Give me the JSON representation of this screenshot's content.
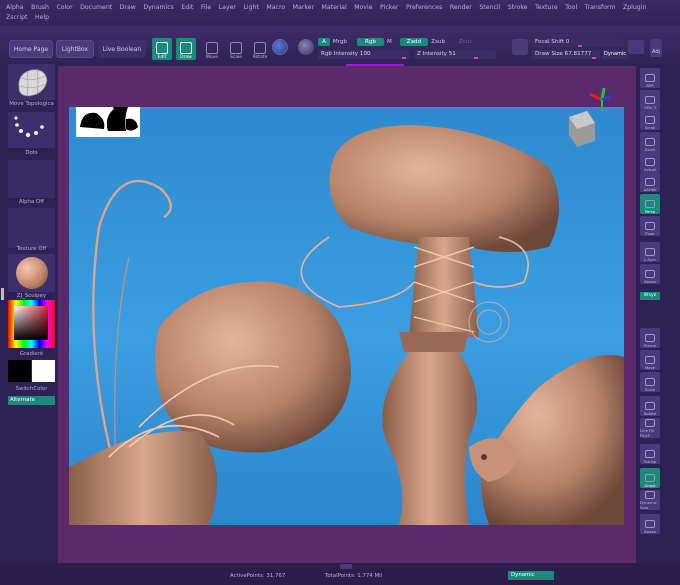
{
  "menu": [
    "Alpha",
    "Brush",
    "Color",
    "Document",
    "Draw",
    "Dynamics",
    "Edit",
    "File",
    "Layer",
    "Light",
    "Macro",
    "Marker",
    "Material",
    "Movie",
    "Picker",
    "Preferences",
    "Render",
    "Stencil",
    "Stroke",
    "Texture",
    "Tool",
    "Transform",
    "Zplugin",
    "Zscript",
    "Help"
  ],
  "shelf": {
    "home_page": "Home Page",
    "lightbox": "LightBox",
    "live_boolean": "Live Boolean",
    "tools": [
      {
        "label": "Edit",
        "on": true
      },
      {
        "label": "Draw",
        "on": true
      },
      {
        "label": "Move",
        "on": false
      },
      {
        "label": "Scale",
        "on": false
      },
      {
        "label": "Rotate",
        "on": false
      }
    ],
    "a_chip": "A",
    "mrgb": "Mrgb",
    "rgb": "Rgb",
    "m": "M",
    "zadd": "Zadd",
    "zsub": "Zsub",
    "zcut": "Zcut",
    "rgb_intensity": "Rgb Intensity 100",
    "z_intensity": "Z Intensity 51",
    "focal_shift": "Focal Shift 0",
    "draw_size": "Draw Size 67.81777",
    "dynamic": "Dynamic",
    "adj": "Adj"
  },
  "left": {
    "brush_label": "Move Topologica",
    "stroke_label": "Dots",
    "alpha_label": "Alpha Off",
    "texture_label": "Texture Off",
    "material_label": "ZJ_Sculpey",
    "gradient_label": "Gradient",
    "switch_color": "SwitchColor",
    "alternate": "Alternate"
  },
  "right": {
    "buttons": [
      {
        "label": "BPR",
        "on": false
      },
      {
        "label": "SPix 3",
        "on": false
      },
      {
        "label": "Scroll",
        "on": false
      },
      {
        "label": "Zoom",
        "on": false
      },
      {
        "label": "Actual",
        "on": false
      },
      {
        "label": "AAHalf",
        "on": false
      },
      {
        "label": "Persp",
        "on": true
      },
      {
        "label": "Floor",
        "on": false
      },
      {
        "label": "L.Sym",
        "on": false
      },
      {
        "label": "Xpose",
        "on": false
      },
      {
        "label": "Frame",
        "on": false
      },
      {
        "label": "Move",
        "on": false
      },
      {
        "label": "Scale",
        "on": false
      },
      {
        "label": "Rotate",
        "on": false
      },
      {
        "label": "Line Fill PolyF",
        "on": false
      },
      {
        "label": "Transp",
        "on": false
      },
      {
        "label": "Ghost",
        "on": true
      },
      {
        "label": "Dynamic Solo",
        "on": false
      },
      {
        "label": "Xpose",
        "on": false
      }
    ],
    "xyz": "Wxyz"
  },
  "status": {
    "active_points": "ActivePoints: 31,767",
    "total_points": "TotalPoints: 1.774 Mil",
    "dynamic": "Dynamic"
  },
  "colors": {
    "accent": "#1b8a7a",
    "canvas_bg": "#3a9ee0",
    "clay": "#c08a72",
    "frame": "#5a2a6a"
  }
}
